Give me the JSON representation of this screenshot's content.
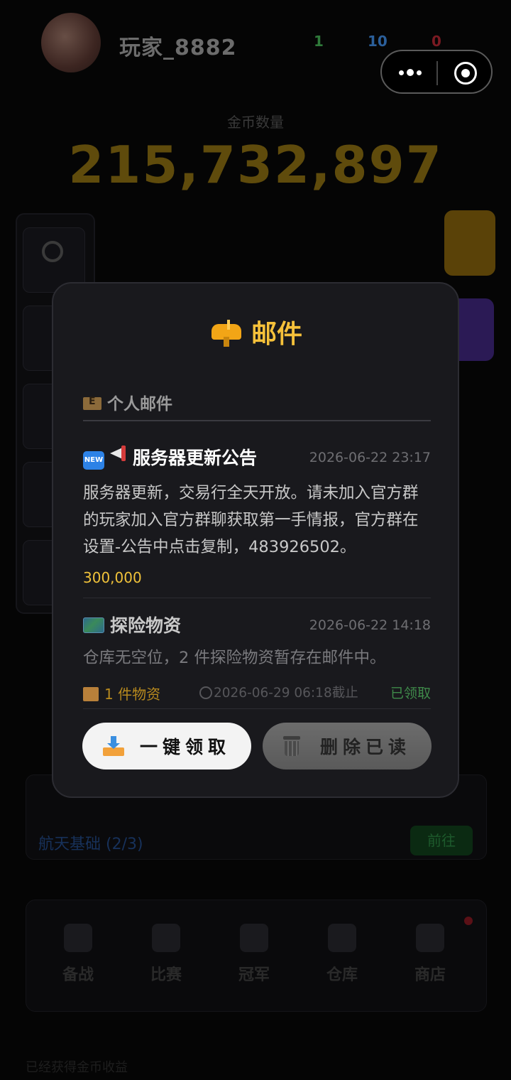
{
  "header": {
    "player_name": "玩家_8882",
    "resources": [
      "1",
      "10",
      "0"
    ]
  },
  "gold": {
    "label": "金币数量",
    "amount": "215,732,897"
  },
  "side_buttons": [
    "设置",
    "",
    "",
    "",
    ""
  ],
  "task": {
    "text": "航天基础 (2/3)",
    "button": "前往"
  },
  "bottom_nav": {
    "items": [
      "备战",
      "比赛",
      "冠军",
      "仓库",
      "商店"
    ]
  },
  "footer": "已经获得金币收益",
  "modal": {
    "title": "邮件",
    "section_label": "个人邮件",
    "mails": [
      {
        "badge": "NEW",
        "title": "服务器更新公告",
        "date": "2026-06-22 23:17",
        "body": "服务器更新，交易行全天开放。请未加入官方群的玩家加入官方群聊获取第一手情报，官方群在设置-公告中点击复制，483926502。",
        "reward": "300,000"
      },
      {
        "title": "探险物资",
        "date": "2026-06-22 14:18",
        "body": "仓库无空位，2 件探险物资暂存在邮件中。",
        "items": "1 件物资",
        "deadline": "2026-06-29 06:18截止",
        "status": "已领取"
      }
    ],
    "claim_all_label": "一键领取",
    "delete_read_label": "删除已读"
  }
}
